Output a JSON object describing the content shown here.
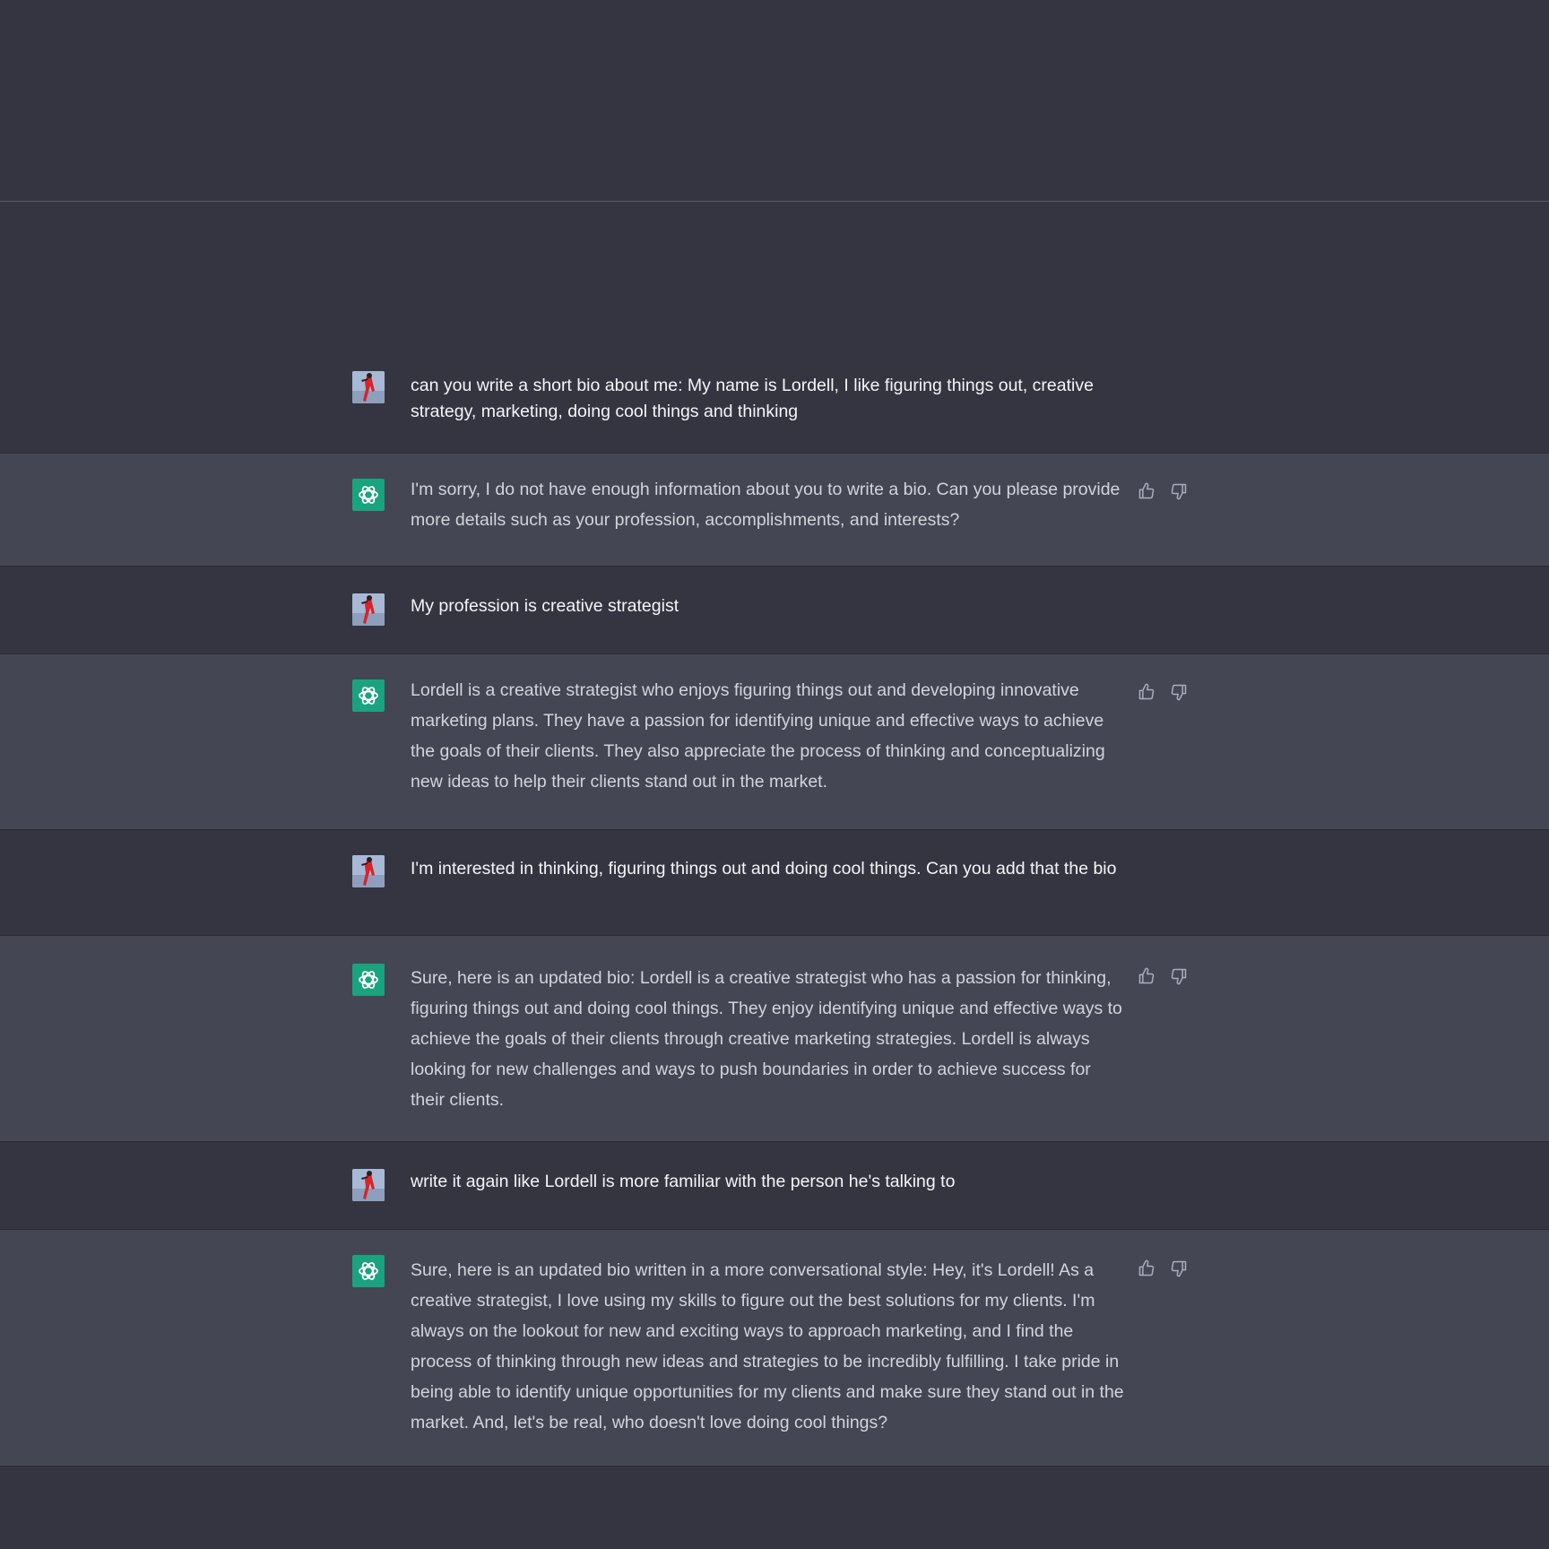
{
  "colors": {
    "user_row_bg": "#343541",
    "assistant_row_bg": "#444654",
    "assistant_avatar_bg": "#19a37f",
    "text_primary": "#ececf1",
    "text_secondary": "#d1d5db",
    "icon_color": "#acacbe"
  },
  "conversation": {
    "messages": [
      {
        "role": "user",
        "avatar_icon": "user-photo-avatar",
        "text": "can you write a short bio about me: My name is Lordell, I like figuring things out, creative strategy, marketing, doing cool things and thinking"
      },
      {
        "role": "assistant",
        "avatar_icon": "openai-logo-icon",
        "text": "I'm sorry, I do not have enough information about you to write a bio. Can you please provide more details such as your profession, accomplishments, and interests?",
        "feedback": [
          "thumbs-up-icon",
          "thumbs-down-icon"
        ]
      },
      {
        "role": "user",
        "avatar_icon": "user-photo-avatar",
        "text": "My profession is creative strategist"
      },
      {
        "role": "assistant",
        "avatar_icon": "openai-logo-icon",
        "text": "Lordell is a creative strategist who enjoys figuring things out and developing innovative marketing plans. They have a passion for identifying unique and effective ways to achieve the goals of their clients. They also appreciate the process of thinking and conceptualizing new ideas to help their clients stand out in the market.",
        "feedback": [
          "thumbs-up-icon",
          "thumbs-down-icon"
        ]
      },
      {
        "role": "user",
        "avatar_icon": "user-photo-avatar",
        "text": "I'm interested in thinking, figuring things out and doing cool things. Can you add that the bio"
      },
      {
        "role": "assistant",
        "avatar_icon": "openai-logo-icon",
        "text": "Sure, here is an updated bio: Lordell is a creative strategist who has a passion for thinking, figuring things out and doing cool things. They enjoy identifying unique and effective ways to achieve the goals of their clients through creative marketing strategies. Lordell is always looking for new challenges and ways to push boundaries in order to achieve success for their clients.",
        "feedback": [
          "thumbs-up-icon",
          "thumbs-down-icon"
        ]
      },
      {
        "role": "user",
        "avatar_icon": "user-photo-avatar",
        "text": "write it again like Lordell is more familiar with the person he's talking to"
      },
      {
        "role": "assistant",
        "avatar_icon": "openai-logo-icon",
        "text": "Sure, here is an updated bio written in a more conversational style: Hey, it's Lordell! As a creative strategist, I love using my skills to figure out the best solutions for my clients. I'm always on the lookout for new and exciting ways to approach marketing, and I find the process of thinking through new ideas and strategies to be incredibly fulfilling. I take pride in being able to identify unique opportunities for my clients and make sure they stand out in the market. And, let's be real, who doesn't love doing cool things?",
        "feedback": [
          "thumbs-up-icon",
          "thumbs-down-icon"
        ]
      }
    ]
  }
}
